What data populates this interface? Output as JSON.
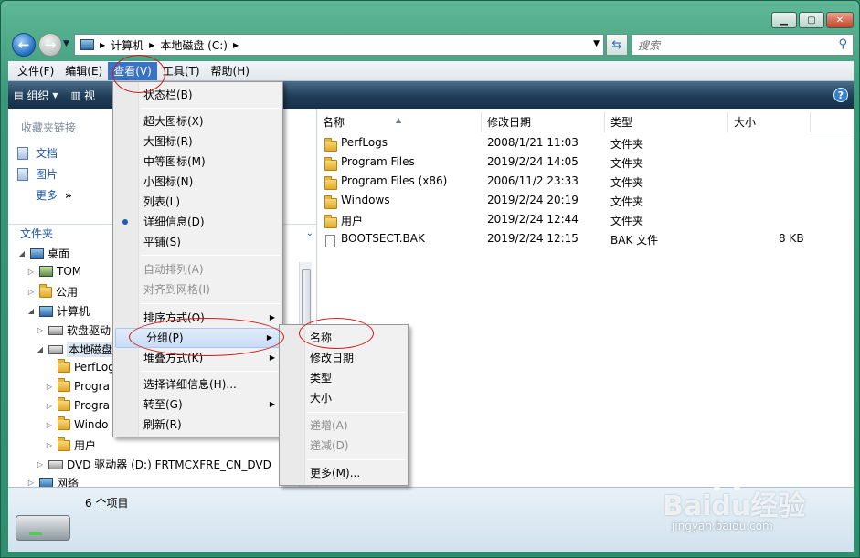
{
  "nav": {
    "address_segments": [
      "计算机",
      "本地磁盘 (C:)"
    ],
    "search_placeholder": "搜索"
  },
  "menubar": {
    "items": [
      "文件(F)",
      "编辑(E)",
      "查看(V)",
      "工具(T)",
      "帮助(H)"
    ],
    "active": "查看(V)"
  },
  "toolbar": {
    "organize": "组织",
    "views_partial": "视"
  },
  "left_pane": {
    "favorites_title": "收藏夹链接",
    "favorites": [
      "文档",
      "图片",
      "更多"
    ],
    "more_glyph": "»",
    "folders_label": "文件夹",
    "tree": [
      "桌面",
      "TOM",
      "公用",
      "计算机",
      "软盘驱动",
      "本地磁盘",
      "PerfLogs",
      "Progra",
      "Progra",
      "Windo",
      "用户",
      "DVD 驱动器 (D:) FRTMCXFRE_CN_DVD",
      "网络"
    ]
  },
  "columns": [
    "名称",
    "修改日期",
    "类型",
    "大小"
  ],
  "files": [
    {
      "name": "PerfLogs",
      "date": "2008/1/21 11:03",
      "type": "文件夹",
      "size": "",
      "icon": "folder-icon"
    },
    {
      "name": "Program Files",
      "date": "2019/2/24 14:05",
      "type": "文件夹",
      "size": "",
      "icon": "folder-icon"
    },
    {
      "name": "Program Files (x86)",
      "date": "2006/11/2 23:33",
      "type": "文件夹",
      "size": "",
      "icon": "folder-icon"
    },
    {
      "name": "Windows",
      "date": "2019/2/24 20:19",
      "type": "文件夹",
      "size": "",
      "icon": "folder-icon"
    },
    {
      "name": "用户",
      "date": "2019/2/24 12:44",
      "type": "文件夹",
      "size": "",
      "icon": "folder-icon"
    },
    {
      "name": "BOOTSECT.BAK",
      "date": "2019/2/24 12:15",
      "type": "BAK 文件",
      "size": "8 KB",
      "icon": "file-icon"
    }
  ],
  "status": {
    "count": "6 个项目"
  },
  "view_menu": {
    "items": [
      {
        "label": "状态栏(B)"
      },
      {
        "label": "超大图标(X)"
      },
      {
        "label": "大图标(R)"
      },
      {
        "label": "中等图标(M)"
      },
      {
        "label": "小图标(N)"
      },
      {
        "label": "列表(L)"
      },
      {
        "label": "详细信息(D)",
        "selected": true
      },
      {
        "label": "平铺(S)"
      },
      {
        "label": "自动排列(A)",
        "disabled": true
      },
      {
        "label": "对齐到网格(I)",
        "disabled": true
      },
      {
        "label": "排序方式(O)",
        "submenu": true
      },
      {
        "label": "分组(P)",
        "submenu": true,
        "highlighted": true
      },
      {
        "label": "堆叠方式(K)",
        "submenu": true
      },
      {
        "label": "选择详细信息(H)..."
      },
      {
        "label": "转至(G)",
        "submenu": true
      },
      {
        "label": "刷新(R)"
      }
    ]
  },
  "group_submenu": {
    "items": [
      {
        "label": "名称"
      },
      {
        "label": "修改日期"
      },
      {
        "label": "类型"
      },
      {
        "label": "大小"
      },
      {
        "label": "递增(A)",
        "disabled": true
      },
      {
        "label": "递减(D)",
        "disabled": true
      },
      {
        "label": "更多(M)..."
      }
    ]
  },
  "watermark": {
    "logo": "Baidu经验",
    "url": "jingyan.baidu.com"
  },
  "colors": {
    "accent": "#3a72c4",
    "window_frame": "#2f8e6e",
    "annotation": "#d21818"
  }
}
